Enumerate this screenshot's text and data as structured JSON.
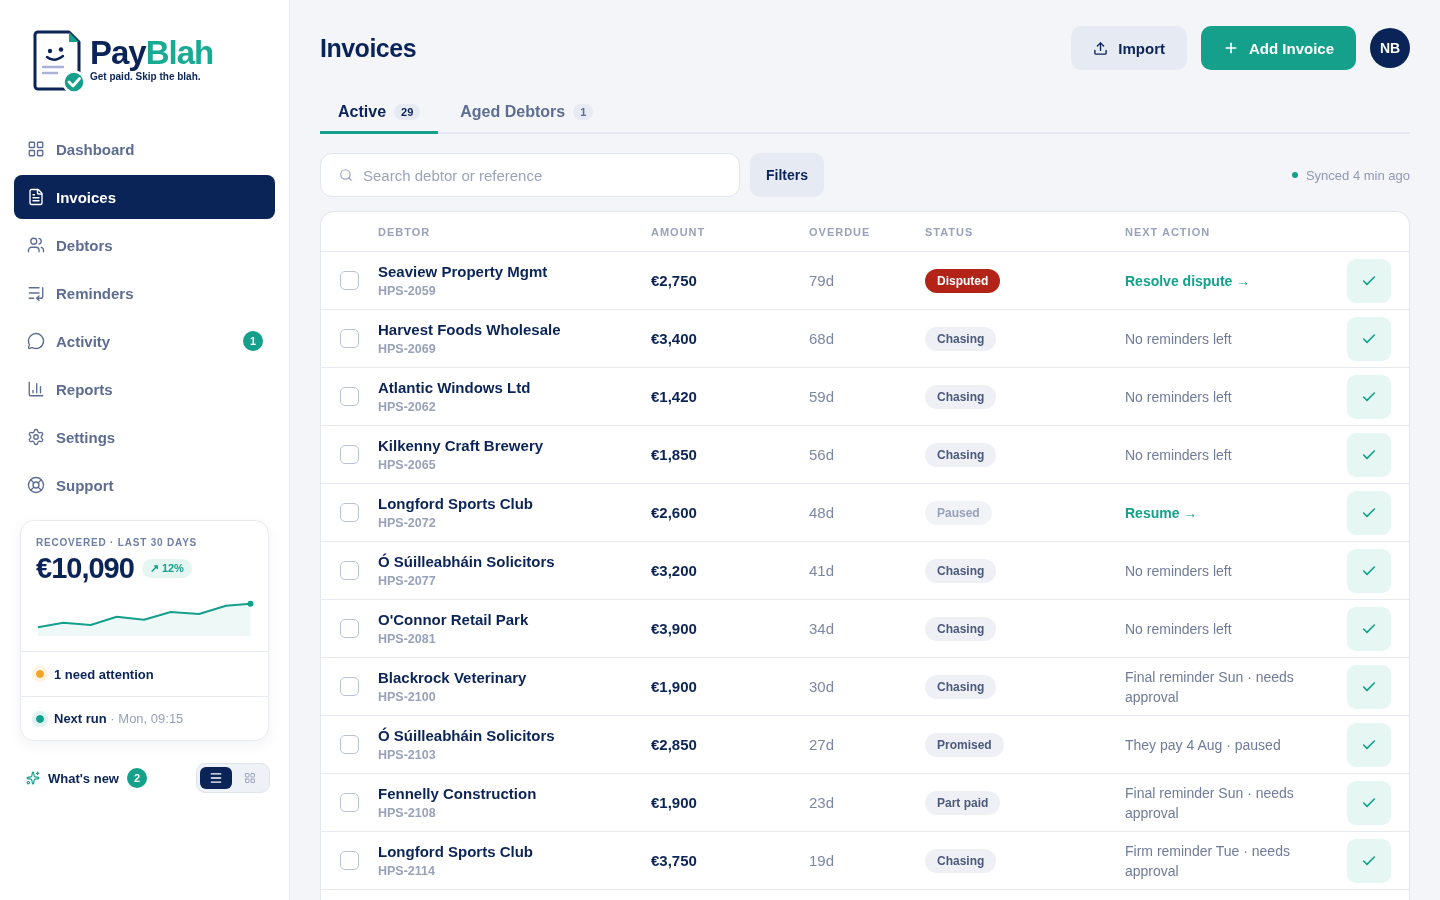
{
  "sidebar": {
    "logo": {
      "wordmark": [
        {
          "text": "Pay",
          "color": "#0b2457"
        },
        {
          "text": "Blah",
          "color": "#17ab93"
        }
      ],
      "tagline": "Get paid. Skip the blah."
    },
    "nav": [
      {
        "label": "Dashboard",
        "selected": false
      },
      {
        "label": "Invoices",
        "selected": true
      },
      {
        "label": "Debtors",
        "selected": false
      },
      {
        "label": "Reminders",
        "selected": false
      },
      {
        "label": "Activity",
        "selected": false,
        "badge": "1"
      },
      {
        "label": "Reports",
        "selected": false
      },
      {
        "label": "Settings",
        "selected": false
      },
      {
        "label": "Support",
        "selected": false
      }
    ],
    "summary_card": {
      "title": "RECOVERED · LAST 30 DAYS",
      "value": "€10,090",
      "change": "↗ 12%",
      "items": [
        {
          "label": "1 need attention",
          "color": "#f5a524"
        },
        {
          "label": "Next run",
          "detail": "· Mon, 09:15",
          "color": "#14a08a"
        }
      ]
    },
    "whats_new": {
      "label": "What's new",
      "badge": "2"
    },
    "view_toggle": [
      {
        "selected": true
      },
      {
        "selected": false
      }
    ]
  },
  "page": {
    "title": "Invoices",
    "buttons": [
      {
        "label": "Import",
        "kind": "secondary"
      },
      {
        "label": "Add Invoice",
        "kind": "primary"
      }
    ],
    "avatar": "NB"
  },
  "tabs": [
    {
      "label": "Active",
      "count": "29",
      "selected": true
    },
    {
      "label": "Aged Debtors",
      "count": "1",
      "selected": false
    }
  ],
  "search": {
    "placeholder": "Search debtor or reference"
  },
  "filters_button": "Filters",
  "sync_status": "Synced 4 min ago",
  "table": {
    "columns": [
      "DEBTOR",
      "AMOUNT",
      "OVERDUE",
      "STATUS",
      "NEXT ACTION"
    ],
    "rows": [
      {
        "checked": false,
        "debtor": "Seaview Property Mgmt",
        "reference": "HPS-2059",
        "amount": "€2,750",
        "overdue": "79d",
        "status": {
          "label": "Disputed",
          "kind": "danger"
        },
        "next_action": {
          "text": "Resolve dispute →",
          "kind": "link"
        }
      },
      {
        "checked": false,
        "debtor": "Harvest Foods Wholesale",
        "reference": "HPS-2069",
        "amount": "€3,400",
        "overdue": "68d",
        "status": {
          "label": "Chasing",
          "kind": "active"
        },
        "next_action": {
          "text": "No reminders left",
          "kind": "note"
        }
      },
      {
        "checked": false,
        "debtor": "Atlantic Windows Ltd",
        "reference": "HPS-2062",
        "amount": "€1,420",
        "overdue": "59d",
        "status": {
          "label": "Chasing",
          "kind": "active"
        },
        "next_action": {
          "text": "No reminders left",
          "kind": "note"
        }
      },
      {
        "checked": false,
        "debtor": "Kilkenny Craft Brewery",
        "reference": "HPS-2065",
        "amount": "€1,850",
        "overdue": "56d",
        "status": {
          "label": "Chasing",
          "kind": "active"
        },
        "next_action": {
          "text": "No reminders left",
          "kind": "note"
        }
      },
      {
        "checked": false,
        "debtor": "Longford Sports Club",
        "reference": "HPS-2072",
        "amount": "€2,600",
        "overdue": "48d",
        "status": {
          "label": "Paused",
          "kind": "muted"
        },
        "next_action": {
          "text": "Resume →",
          "kind": "link"
        }
      },
      {
        "checked": false,
        "debtor": "Ó Súilleabháin Solicitors",
        "reference": "HPS-2077",
        "amount": "€3,200",
        "overdue": "41d",
        "status": {
          "label": "Chasing",
          "kind": "active"
        },
        "next_action": {
          "text": "No reminders left",
          "kind": "note"
        }
      },
      {
        "checked": false,
        "debtor": "O'Connor Retail Park",
        "reference": "HPS-2081",
        "amount": "€3,900",
        "overdue": "34d",
        "status": {
          "label": "Chasing",
          "kind": "active"
        },
        "next_action": {
          "text": "No reminders left",
          "kind": "note"
        }
      },
      {
        "checked": false,
        "debtor": "Blackrock Veterinary",
        "reference": "HPS-2100",
        "amount": "€1,900",
        "overdue": "30d",
        "status": {
          "label": "Chasing",
          "kind": "active"
        },
        "next_action": {
          "text": "Final reminder Sun · needs approval",
          "kind": "note"
        }
      },
      {
        "checked": false,
        "debtor": "Ó Súilleabháin Solicitors",
        "reference": "HPS-2103",
        "amount": "€2,850",
        "overdue": "27d",
        "status": {
          "label": "Promised",
          "kind": "active"
        },
        "next_action": {
          "text": "They pay 4 Aug · paused",
          "kind": "note"
        }
      },
      {
        "checked": false,
        "debtor": "Fennelly Construction",
        "reference": "HPS-2108",
        "amount": "€1,900",
        "overdue": "23d",
        "status": {
          "label": "Part paid",
          "kind": "active"
        },
        "next_action": {
          "text": "Final reminder Sun · needs approval",
          "kind": "note"
        }
      },
      {
        "checked": false,
        "debtor": "Longford Sports Club",
        "reference": "HPS-2114",
        "amount": "€3,750",
        "overdue": "19d",
        "status": {
          "label": "Chasing",
          "kind": "active"
        },
        "next_action": {
          "text": "Firm reminder Tue · needs approval",
          "kind": "note"
        }
      }
    ]
  }
}
